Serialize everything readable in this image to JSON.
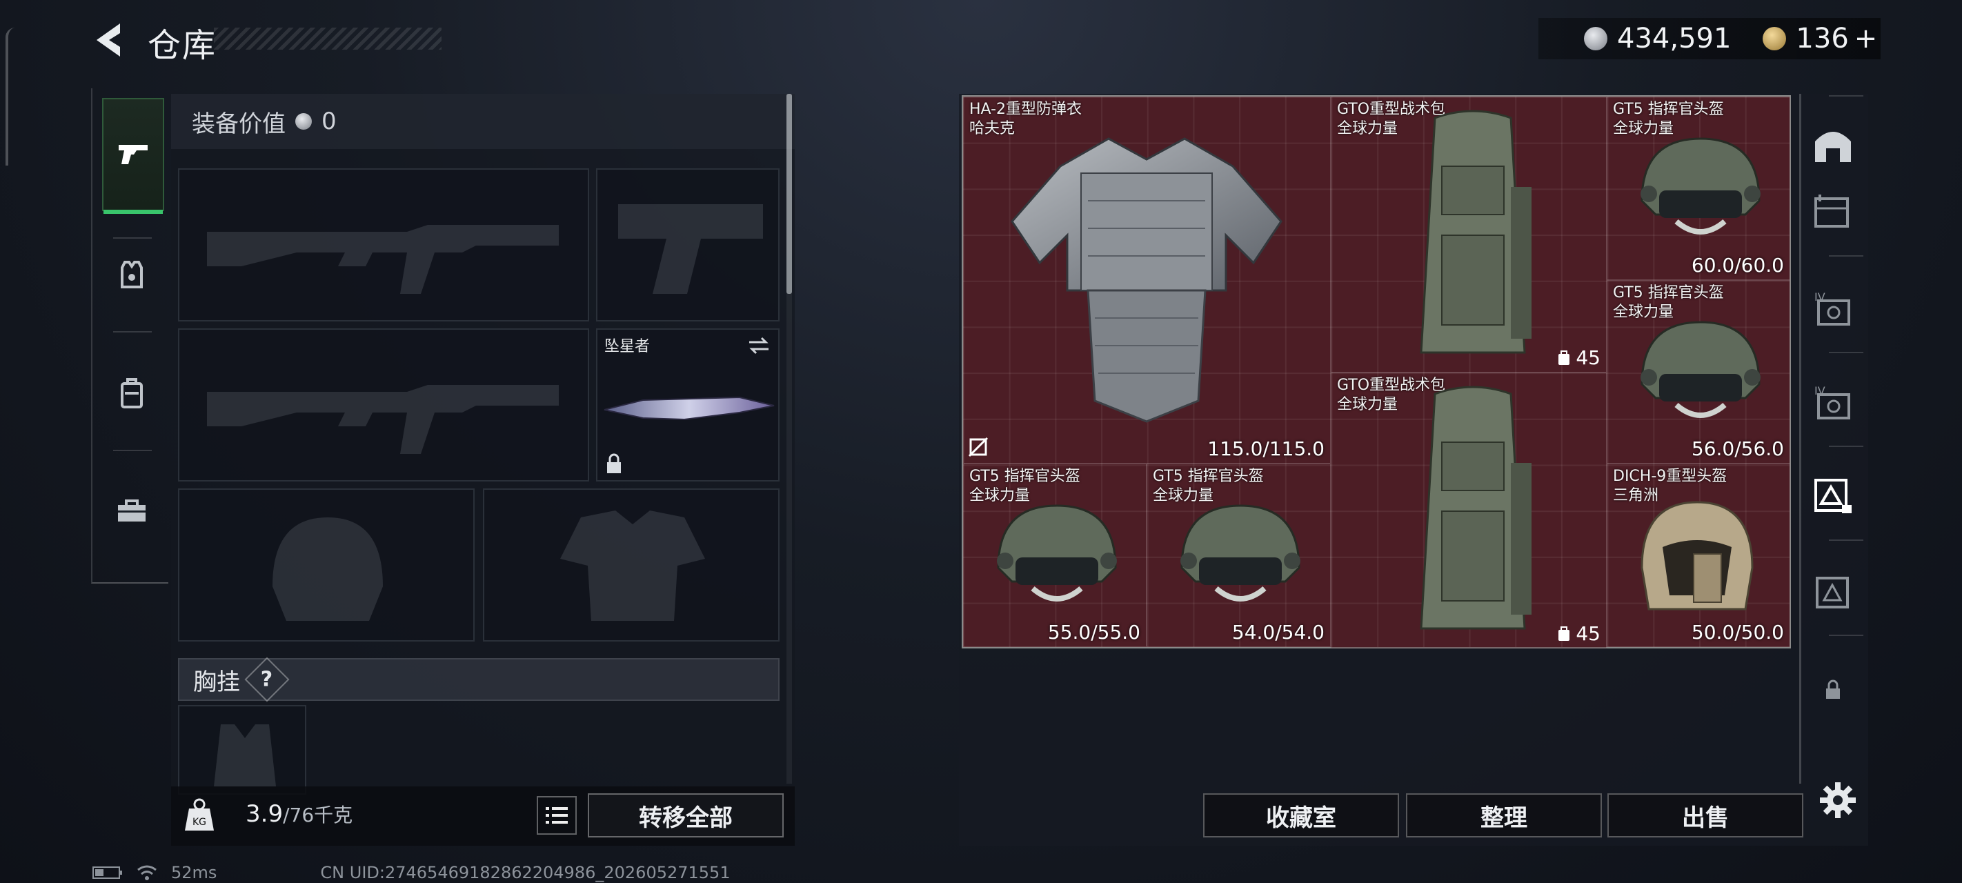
{
  "header": {
    "title": "仓库"
  },
  "currency": {
    "coins": "434,591",
    "premium": "136",
    "premium_add": "+"
  },
  "left_tabs": [
    {
      "name": "weapon-tab",
      "icon": "pistol-icon",
      "active": true
    },
    {
      "name": "armor-tab",
      "icon": "vest-icon",
      "active": false
    },
    {
      "name": "backpack-tab",
      "icon": "backpack-icon",
      "active": false
    },
    {
      "name": "toolbox-tab",
      "icon": "toolbox-icon",
      "active": false
    }
  ],
  "equipment": {
    "value_label": "装备价值",
    "value": "0",
    "melee_name": "坠星者",
    "chest_rig_label": "胸挂",
    "help": "?",
    "weight_current": "3.9",
    "weight_max": "/76千克",
    "transfer_all": "转移全部"
  },
  "storage": {
    "items": [
      {
        "name": "HA-2重型防弹衣",
        "brand": "哈夫克",
        "durability": "115.0/115.0",
        "kind": "vest"
      },
      {
        "name": "GTO重型战术包",
        "brand": "全球力量",
        "capacity": "45",
        "kind": "backpack"
      },
      {
        "name": "GT5 指挥官头盔",
        "brand": "全球力量",
        "durability": "60.0/60.0",
        "kind": "helmet"
      },
      {
        "name": "GT5 指挥官头盔",
        "brand": "全球力量",
        "durability": "56.0/56.0",
        "kind": "helmet"
      },
      {
        "name": "GTO重型战术包",
        "brand": "全球力量",
        "capacity": "45",
        "kind": "backpack"
      },
      {
        "name": "GT5 指挥官头盔",
        "brand": "全球力量",
        "durability": "55.0/55.0",
        "kind": "helmet"
      },
      {
        "name": "GT5 指挥官头盔",
        "brand": "全球力量",
        "durability": "54.0/54.0",
        "kind": "helmet"
      },
      {
        "name": "DICH-9重型头盔",
        "brand": "三角洲",
        "durability": "50.0/50.0",
        "kind": "helmet-tan"
      }
    ]
  },
  "actions": {
    "collection": "收藏室",
    "organize": "整理",
    "sell": "出售"
  },
  "status": {
    "ping": "52ms",
    "uid": "CN UID:27465469182862204986_202605271551"
  },
  "colors": {
    "grid_bg": "#4a1e25",
    "active_tab_accent": "#39c46b"
  }
}
